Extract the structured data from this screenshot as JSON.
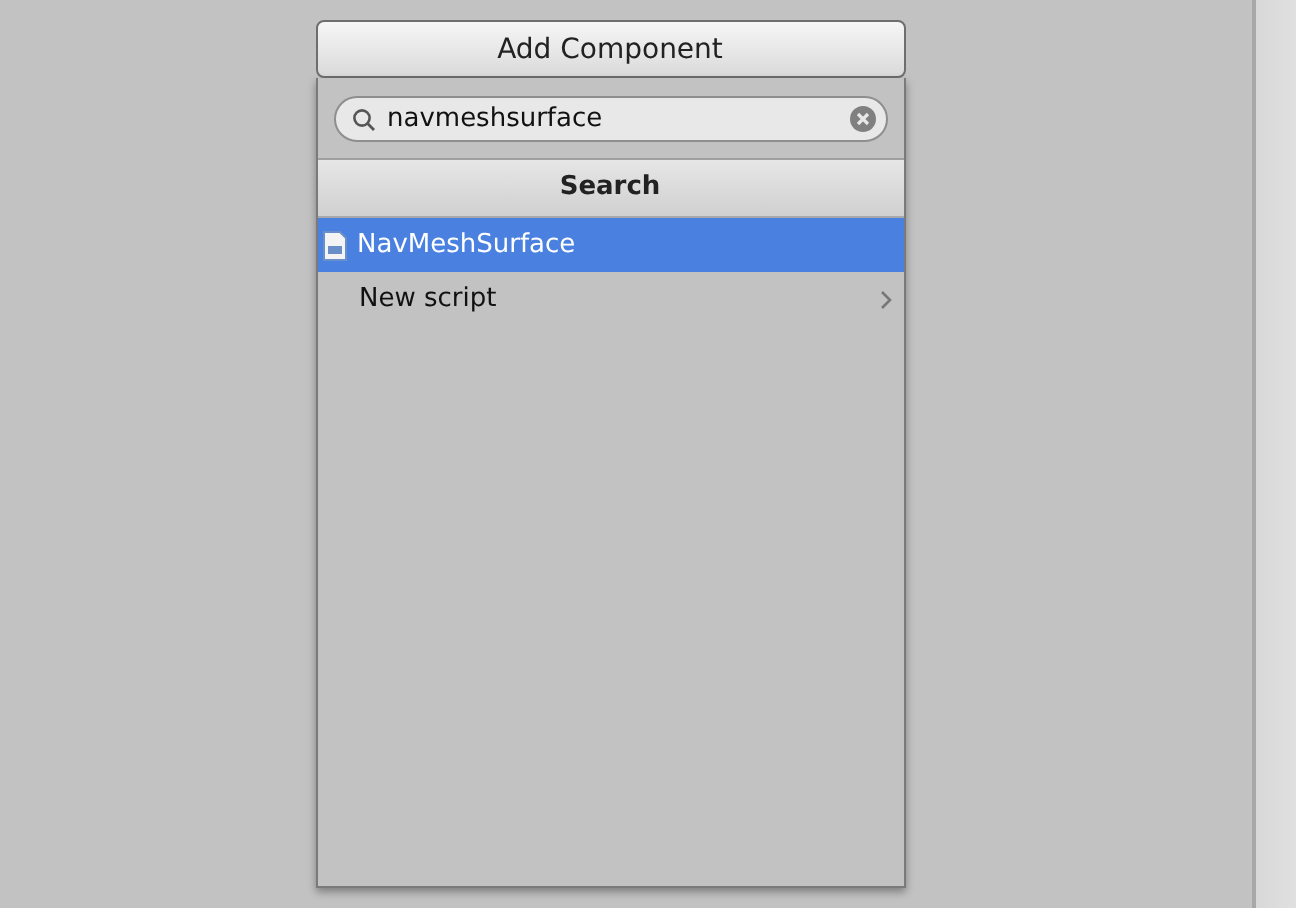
{
  "add_component_button": {
    "label": "Add Component"
  },
  "popup": {
    "search": {
      "value": "navmeshsurface"
    },
    "header": "Search",
    "items": [
      {
        "label": "NavMeshSurface",
        "kind": "script",
        "selected": true
      },
      {
        "label": "New script",
        "kind": "submenu",
        "selected": false
      }
    ]
  }
}
